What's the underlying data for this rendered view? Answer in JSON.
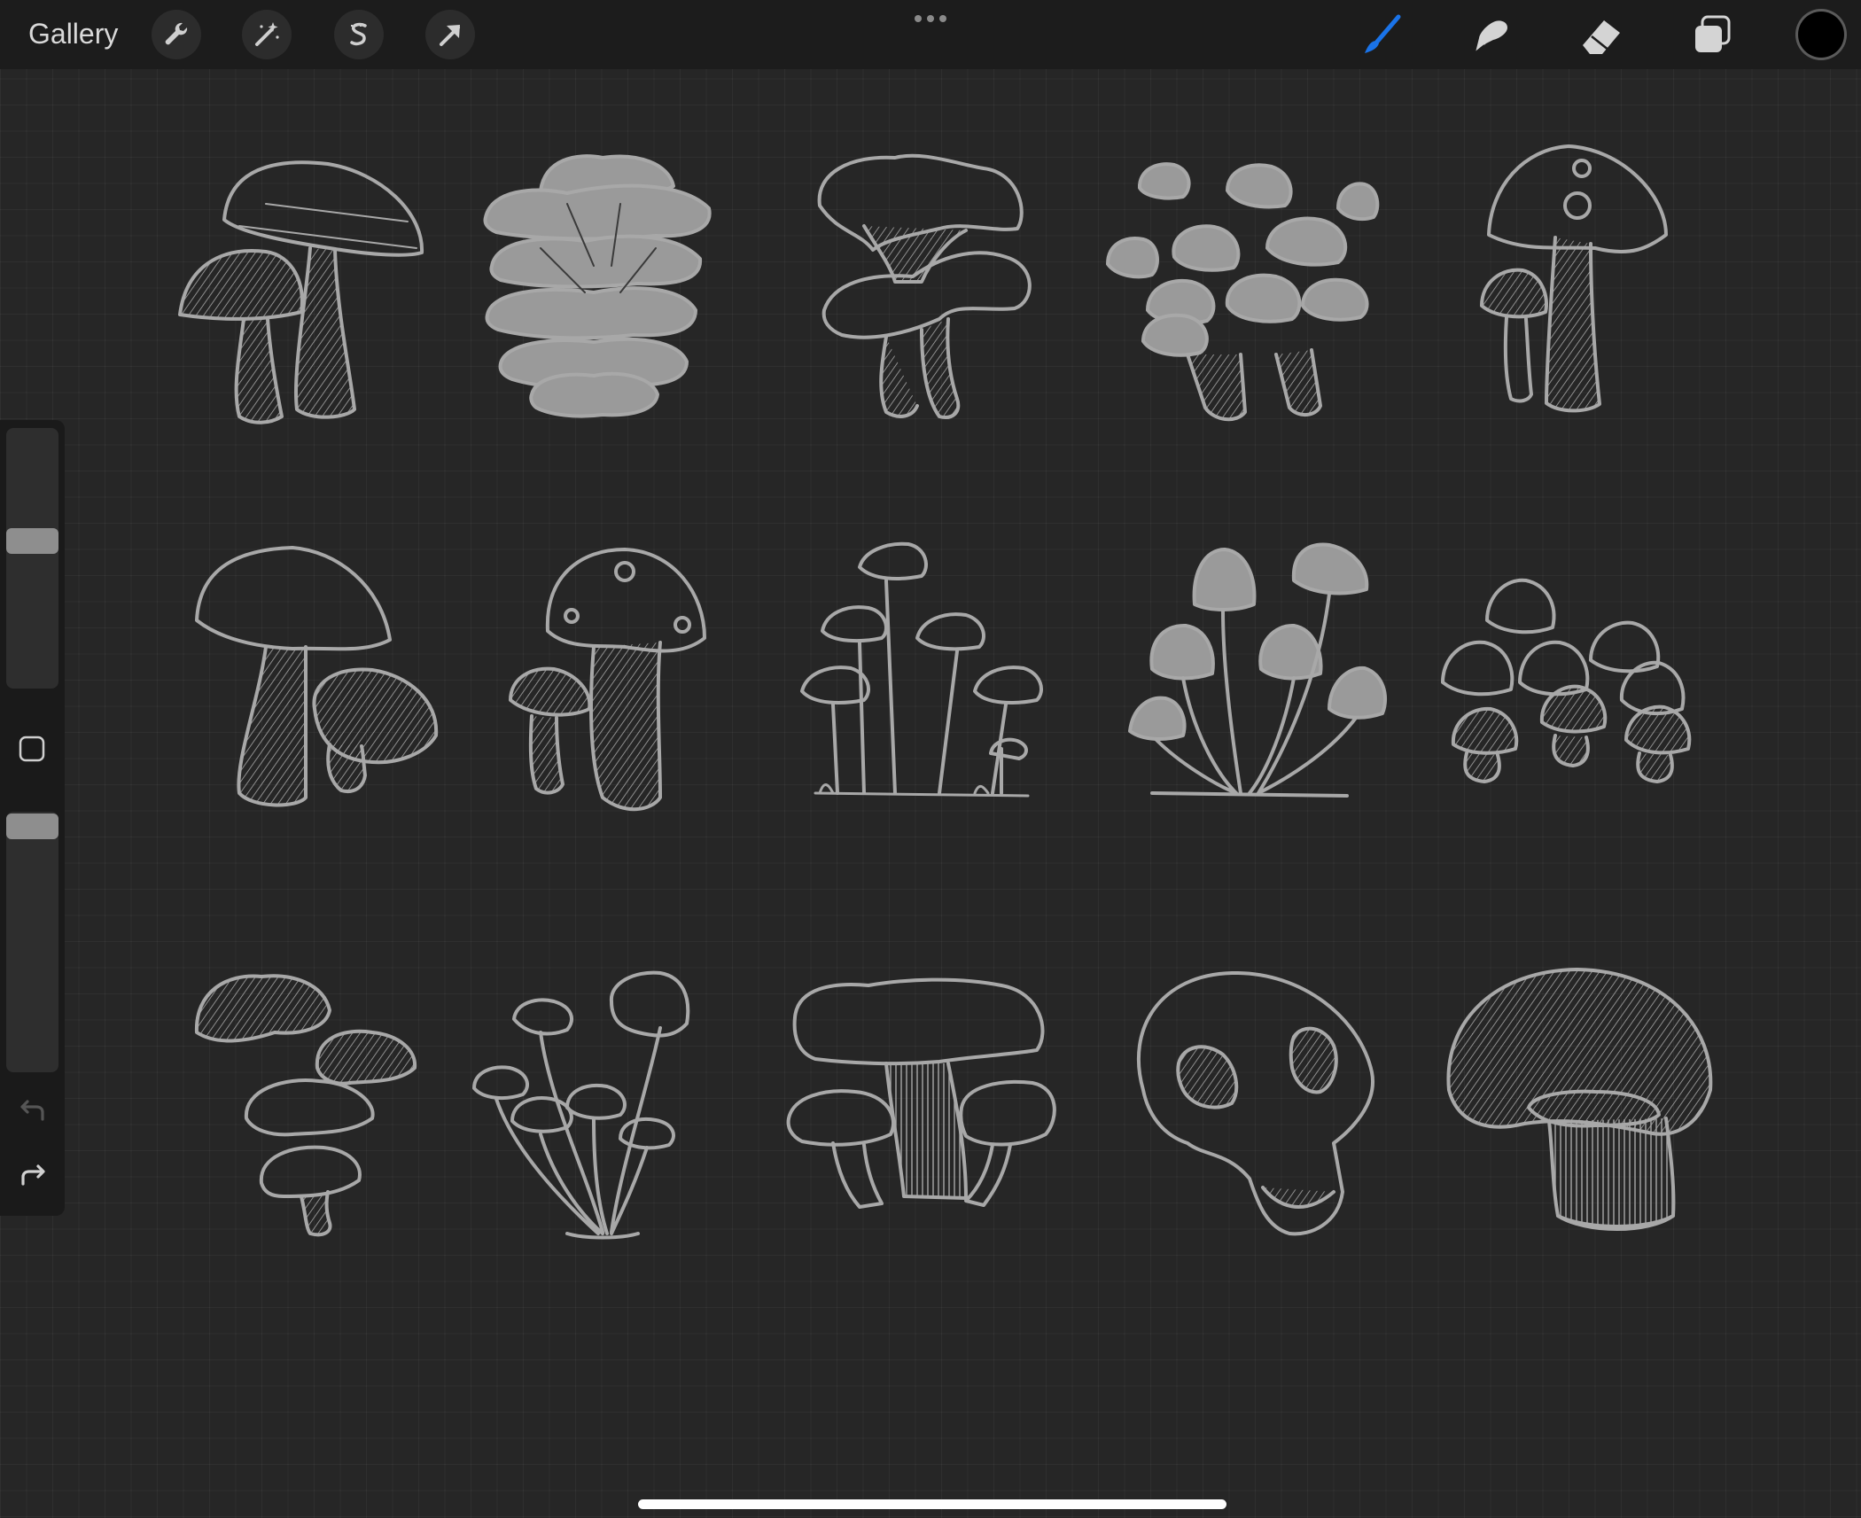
{
  "topbar": {
    "gallery_label": "Gallery",
    "left_tools": [
      "wrench-icon",
      "magic-wand-icon",
      "selection-s-icon",
      "transform-arrow-icon"
    ],
    "more_icon": "ellipsis-icon",
    "right_tools": [
      "brush-icon",
      "smudge-icon",
      "eraser-icon",
      "layers-icon"
    ],
    "active_tool": "brush",
    "active_color": "#1a73e8",
    "current_color": "#000000"
  },
  "sidebar": {
    "brush_size_slider": {
      "level": 0.55
    },
    "opacity_slider": {
      "level": 0.95
    },
    "modify_icon": "square-outline-icon",
    "undo_icon": "undo-arrow-icon",
    "redo_icon": "redo-arrow-icon"
  },
  "canvas": {
    "background": "#262626",
    "grid": true,
    "stroke_color": "#a8a8a8",
    "artwork_subjects": [
      "mushroom-pair-large",
      "oyster-mushroom-cluster",
      "chanterelle-pair",
      "enoki-cluster-filled",
      "spotted-mushroom-pair",
      "mushroom-pair-cap",
      "spotted-bolete-pair",
      "tall-thin-mushrooms-grass",
      "bell-mushroom-fan",
      "small-mushroom-cluster",
      "chanterelle-stack",
      "slender-mushroom-cluster",
      "chanterelle-trio",
      "mushroom-cross-section",
      "champignon-large"
    ]
  }
}
